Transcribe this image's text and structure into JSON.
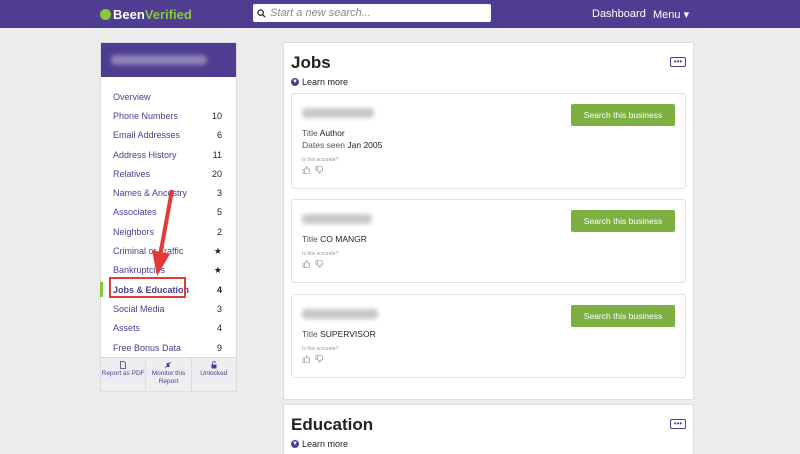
{
  "header": {
    "logo_text_a": "Been",
    "logo_text_b": "Verified",
    "search_placeholder": "Start a new search...",
    "dashboard": "Dashboard",
    "menu": "Menu ▾"
  },
  "sidebar": {
    "items": [
      {
        "label": "Overview",
        "count": ""
      },
      {
        "label": "Phone Numbers",
        "count": "10"
      },
      {
        "label": "Email Addresses",
        "count": "6"
      },
      {
        "label": "Address History",
        "count": "11"
      },
      {
        "label": "Relatives",
        "count": "20"
      },
      {
        "label": "Names & Ancestry",
        "count": "3"
      },
      {
        "label": "Associates",
        "count": "5"
      },
      {
        "label": "Neighbors",
        "count": "2"
      },
      {
        "label": "Criminal or Traffic",
        "count": "★"
      },
      {
        "label": "Bankruptcies",
        "count": "★"
      },
      {
        "label": "Jobs & Education",
        "count": "4"
      },
      {
        "label": "Social Media",
        "count": "3"
      },
      {
        "label": "Assets",
        "count": "4"
      },
      {
        "label": "Free Bonus Data",
        "count": "9"
      }
    ],
    "active_index": 10,
    "footer": {
      "pdf": "Report as PDF",
      "monitor": "Monitor this Report",
      "unlocked": "Unlocked"
    }
  },
  "jobs": {
    "title": "Jobs",
    "learn_more": "Learn more",
    "entries": [
      {
        "title_label": "Title",
        "title_value": "Author",
        "dates_label": "Dates seen",
        "dates_value": "Jan 2005",
        "button": "Search this business",
        "accurate": "Is this accurate?"
      },
      {
        "title_label": "Title",
        "title_value": "CO MANGR",
        "dates_label": "",
        "dates_value": "",
        "button": "Search this business",
        "accurate": "Is this accurate?"
      },
      {
        "title_label": "Title",
        "title_value": "SUPERVISOR",
        "dates_label": "",
        "dates_value": "",
        "button": "Search this business",
        "accurate": "Is this accurate?"
      }
    ]
  },
  "education": {
    "title": "Education",
    "learn_more": "Learn more"
  },
  "colors": {
    "brand_purple": "#4e3d91",
    "brand_green": "#8cc63f",
    "button_green": "#7db043",
    "annotation_red": "#e53935"
  }
}
